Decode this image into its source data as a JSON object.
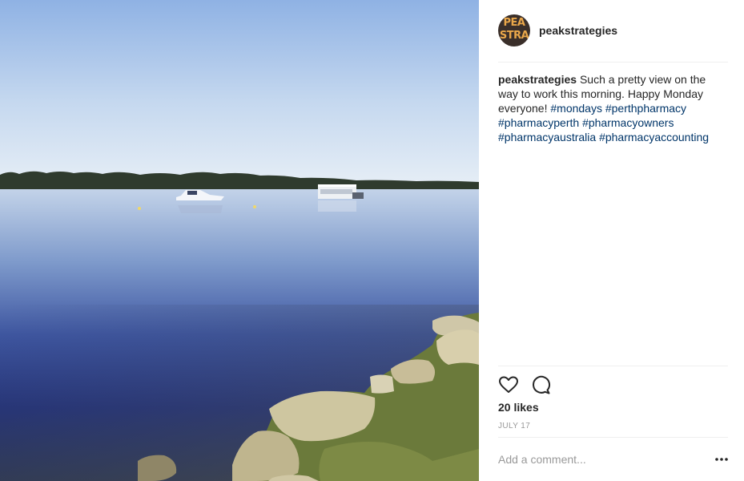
{
  "post": {
    "image_alt": "Lake view at morning with boats and rocky shore"
  },
  "header": {
    "avatar_text_line1": "PEA",
    "avatar_text_line2": "STRA",
    "username": "peakstrategies"
  },
  "caption": {
    "username": "peakstrategies",
    "text": "Such a pretty view on the way to work this morning. Happy Monday everyone!",
    "hashtags": [
      "#mondays",
      "#perthpharmacy",
      "#pharmacyperth",
      "#pharmacyowners",
      "#pharmacyaustralia",
      "#pharmacyaccounting"
    ]
  },
  "actions": {
    "like_icon": "heart-icon",
    "comment_icon": "comment-bubble-icon"
  },
  "likes": "20 likes",
  "date": "JULY 17",
  "comment": {
    "placeholder": "Add a comment...",
    "more_icon": "more-options-icon"
  },
  "colors": {
    "hashtag": "#003569",
    "muted": "#999999",
    "text": "#262626"
  }
}
